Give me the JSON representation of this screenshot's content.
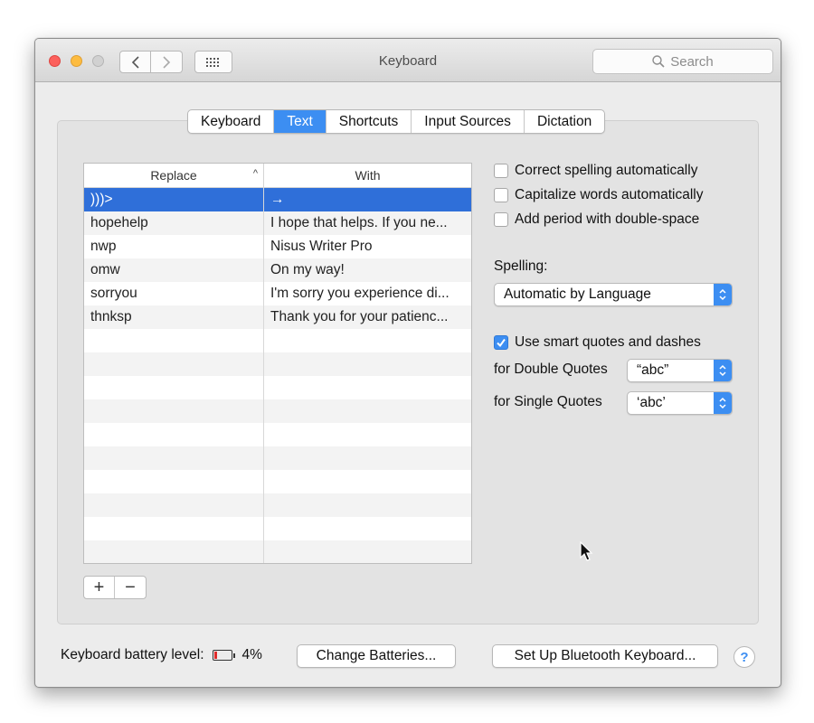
{
  "window": {
    "title": "Keyboard",
    "search_placeholder": "Search"
  },
  "tabs": [
    {
      "label": "Keyboard",
      "active": false
    },
    {
      "label": "Text",
      "active": true
    },
    {
      "label": "Shortcuts",
      "active": false
    },
    {
      "label": "Input Sources",
      "active": false
    },
    {
      "label": "Dictation",
      "active": false
    }
  ],
  "table": {
    "columns": [
      "Replace",
      "With"
    ],
    "sort_indicator": "^",
    "rows": [
      {
        "replace": ")))>",
        "with": "→",
        "selected": true
      },
      {
        "replace": "hopehelp",
        "with": "I hope that helps. If you ne...",
        "selected": false
      },
      {
        "replace": "nwp",
        "with": "Nisus Writer Pro",
        "selected": false
      },
      {
        "replace": "omw",
        "with": "On my way!",
        "selected": false
      },
      {
        "replace": "sorryou",
        "with": "I'm sorry you experience di...",
        "selected": false
      },
      {
        "replace": "thnksp",
        "with": "Thank you for your patienc...",
        "selected": false
      }
    ],
    "empty_rows": 10
  },
  "buttons": {
    "add": "+",
    "remove": "−",
    "change_batteries": "Change Batteries...",
    "bluetooth": "Set Up Bluetooth Keyboard...",
    "help": "?"
  },
  "options": {
    "correct_spelling": {
      "label": "Correct spelling automatically",
      "checked": false
    },
    "capitalize": {
      "label": "Capitalize words automatically",
      "checked": false
    },
    "add_period": {
      "label": "Add period with double-space",
      "checked": false
    },
    "spelling_label": "Spelling:",
    "spelling_value": "Automatic by Language",
    "smart_quotes": {
      "label": "Use smart quotes and dashes",
      "checked": true
    },
    "double_quotes_label": "for Double Quotes",
    "double_quotes_value": "“abc”",
    "single_quotes_label": "for Single Quotes",
    "single_quotes_value": "‘abc’"
  },
  "battery": {
    "label": "Keyboard battery level:",
    "percent": "4%",
    "level": 0.04
  },
  "colors": {
    "accent": "#3c8ef2",
    "selection": "#2f6fd9",
    "battery_low": "#e02b2b"
  }
}
